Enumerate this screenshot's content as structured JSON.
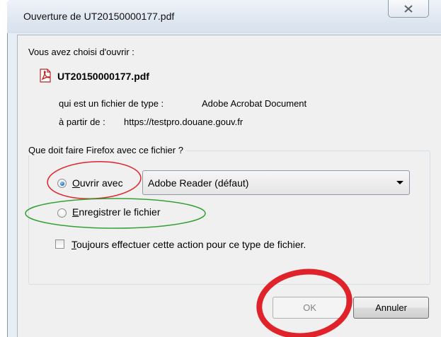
{
  "window": {
    "title": "Ouverture de UT20150000177.pdf",
    "close_icon": "close-x-icon"
  },
  "intro": {
    "label": "Vous avez choisi d'ouvrir :",
    "file_icon": "pdf-file-icon",
    "file_name": "UT20150000177.pdf",
    "file_type_label": "qui est un fichier de type :",
    "file_type_value": "Adobe Acrobat Document",
    "source_label": "à partir de :",
    "source_value": "https://testpro.douane.gouv.fr"
  },
  "action_group": {
    "legend": "Que doit faire Firefox avec ce fichier ?",
    "open_with": {
      "label_accel": "O",
      "label_rest": "uvrir avec",
      "checked": true
    },
    "application_select": {
      "selected": "Adobe Reader  (défaut)"
    },
    "save_file": {
      "label_accel": "E",
      "label_rest": "nregistrer le fichier",
      "checked": false
    },
    "always_do": {
      "label_accel": "T",
      "label_rest": "oujours effectuer cette action pour ce type de fichier.",
      "checked": false
    }
  },
  "buttons": {
    "ok": "OK",
    "ok_disabled": true,
    "cancel": "Annuler"
  },
  "annotations": {
    "open_with_circle_color": "#e0232a",
    "save_file_circle_color": "#35a135",
    "ok_circle_color": "#e0232a"
  }
}
